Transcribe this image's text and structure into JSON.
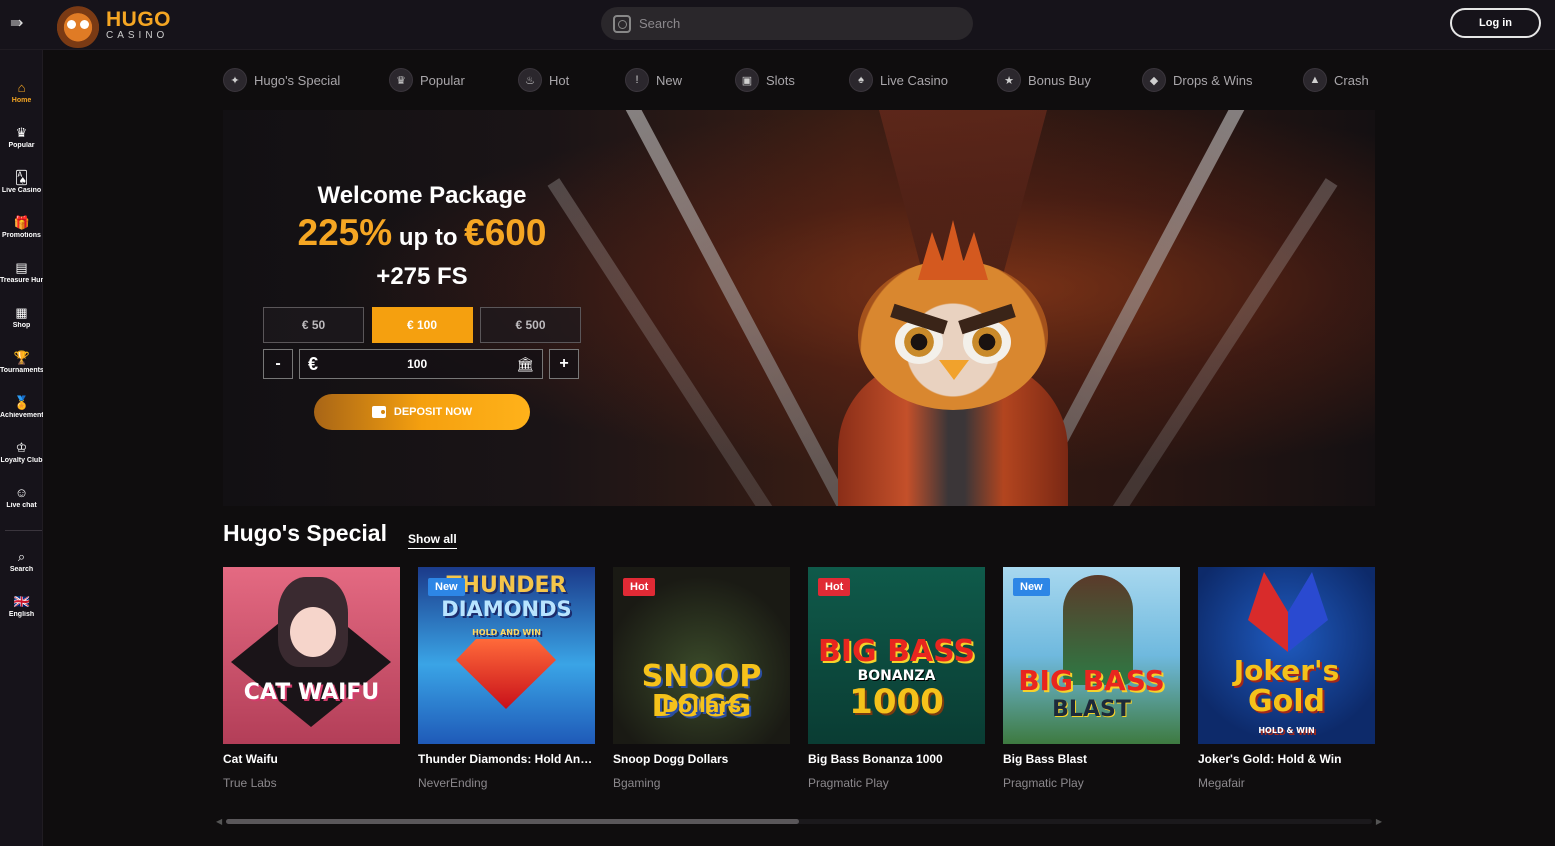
{
  "header": {
    "logo_title": "HUGO",
    "logo_sub": "CASINO",
    "search_placeholder": "Search",
    "login_label": "Log in"
  },
  "sidebar": {
    "items": [
      {
        "label": "Home",
        "icon": "home-icon",
        "glyph": "⌂",
        "active": true
      },
      {
        "label": "Popular",
        "icon": "crown-icon",
        "glyph": "♛"
      },
      {
        "label": "Live Casino",
        "icon": "cards-icon",
        "glyph": "🂡"
      },
      {
        "label": "Promotions",
        "icon": "gift-icon",
        "glyph": "🎁"
      },
      {
        "label": "Treasure Hunt",
        "icon": "treasure-icon",
        "glyph": "▤"
      },
      {
        "label": "Shop",
        "icon": "shop-icon",
        "glyph": "▦"
      },
      {
        "label": "Tournaments",
        "icon": "trophy-icon",
        "glyph": "🏆"
      },
      {
        "label": "Achievements",
        "icon": "medal-icon",
        "glyph": "🏅"
      },
      {
        "label": "Loyalty Club",
        "icon": "crown-icon",
        "glyph": "♔"
      },
      {
        "label": "Live chat",
        "icon": "chat-icon",
        "glyph": "☺"
      },
      {
        "label": "Search",
        "icon": "search-icon",
        "glyph": "⌕"
      },
      {
        "label": "English",
        "icon": "uk-flag-icon",
        "glyph": "🇬🇧"
      }
    ]
  },
  "categories": [
    {
      "label": "Hugo's Special",
      "icon": "special-icon"
    },
    {
      "label": "Popular",
      "icon": "crown-icon"
    },
    {
      "label": "Hot",
      "icon": "flame-icon"
    },
    {
      "label": "New",
      "icon": "new-icon"
    },
    {
      "label": "Slots",
      "icon": "slot-machine-icon"
    },
    {
      "label": "Live Casino",
      "icon": "cards-icon"
    },
    {
      "label": "Bonus Buy",
      "icon": "bonus-icon"
    },
    {
      "label": "Drops & Wins",
      "icon": "drops-icon"
    },
    {
      "label": "Crash",
      "icon": "rocket-icon"
    }
  ],
  "promo": {
    "title": "Welcome Package",
    "percent": "225%",
    "up_to": " up to ",
    "max_bonus": "€600",
    "free_spins": "+275 FS",
    "amount_options": [
      "€ 50",
      "€ 100",
      "€ 500"
    ],
    "selected_amount_index": 1,
    "currency_symbol": "€",
    "amount_value": "100",
    "minus_label": "-",
    "plus_label": "+",
    "deposit_label": "DEPOSIT NOW"
  },
  "section": {
    "title": "Hugo's Special",
    "show_all": "Show all"
  },
  "games": [
    {
      "name": "Cat Waifu",
      "provider": "True Labs",
      "badge": "",
      "art": [
        "CAT WAIFU"
      ]
    },
    {
      "name": "Thunder Diamonds: Hold And ...",
      "provider": "NeverEnding",
      "badge": "New",
      "art": [
        "THUNDER",
        "DIAMONDS",
        "HOLD AND WIN"
      ]
    },
    {
      "name": "Snoop Dogg Dollars",
      "provider": "Bgaming",
      "badge": "Hot",
      "art": [
        "SNOOP DOGG",
        "Dollars"
      ]
    },
    {
      "name": "Big Bass Bonanza 1000",
      "provider": "Pragmatic Play",
      "badge": "Hot",
      "art": [
        "BIG BASS",
        "BONANZA",
        "1000"
      ]
    },
    {
      "name": "Big Bass Blast",
      "provider": "Pragmatic Play",
      "badge": "New",
      "art": [
        "BIG BASS",
        "BLAST"
      ]
    },
    {
      "name": "Joker's Gold: Hold & Win",
      "provider": "Megafair",
      "badge": "",
      "art": [
        "Joker's",
        "Gold",
        "HOLD & WIN"
      ]
    }
  ],
  "carousel_scroll": {
    "position_fraction": 0.0,
    "visible_fraction": 0.5
  },
  "colors": {
    "accent": "#f5a00f",
    "hot": "#e02a35",
    "new": "#2d86e6",
    "background": "#0f0d0e"
  }
}
